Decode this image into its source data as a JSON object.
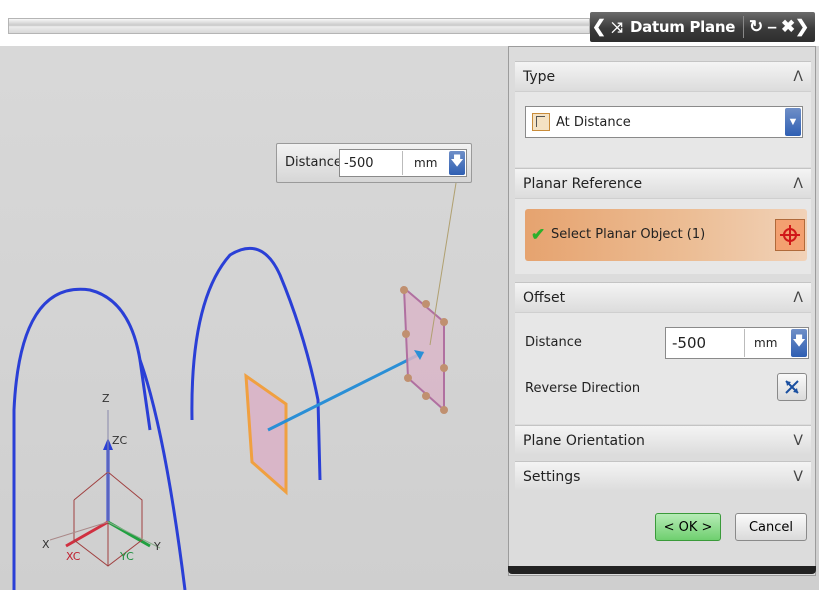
{
  "dialog": {
    "title": "Datum Plane",
    "nav_prev_icon": "chevron-left-icon",
    "nav_next_icon": "chevron-right-icon",
    "pin_icon": "pin-icon",
    "reset_icon": "reset-icon",
    "minimize_icon": "minimize-icon",
    "close_icon": "close-icon"
  },
  "type_section": {
    "title": "Type",
    "collapse_icon": "chevron-up-icon",
    "selected": "At Distance",
    "selected_icon": "at-distance-icon"
  },
  "planar_reference": {
    "title": "Planar Reference",
    "collapse_icon": "chevron-up-icon",
    "select_label": "Select Planar Object (1)",
    "check_icon": "checkmark-icon",
    "selector_icon": "crosshair-icon",
    "highlight_color": "#e6a36f"
  },
  "offset": {
    "title": "Offset",
    "collapse_icon": "chevron-up-icon",
    "distance_label": "Distance",
    "distance_value": "-500",
    "distance_unit": "mm",
    "reverse_label": "Reverse Direction",
    "reverse_icon": "reverse-direction-icon"
  },
  "plane_orientation": {
    "title": "Plane Orientation",
    "expand_icon": "chevron-down-icon"
  },
  "settings": {
    "title": "Settings",
    "expand_icon": "chevron-down-icon"
  },
  "buttons": {
    "ok": "< OK >",
    "cancel": "Cancel"
  },
  "float_widget": {
    "label": "Distance",
    "value": "-500",
    "unit": "mm"
  },
  "axes": {
    "z": "Z",
    "zc": "ZC",
    "x": "X",
    "xc": "XC",
    "y": "Y",
    "yc": "YC"
  },
  "colors": {
    "accent_blue": "#2f5fb3",
    "curve": "#2a3fd6",
    "plane_fill": "#d9b6c8",
    "plane_edge_orange": "#f0a040",
    "ok_green": "#7ed07e"
  }
}
